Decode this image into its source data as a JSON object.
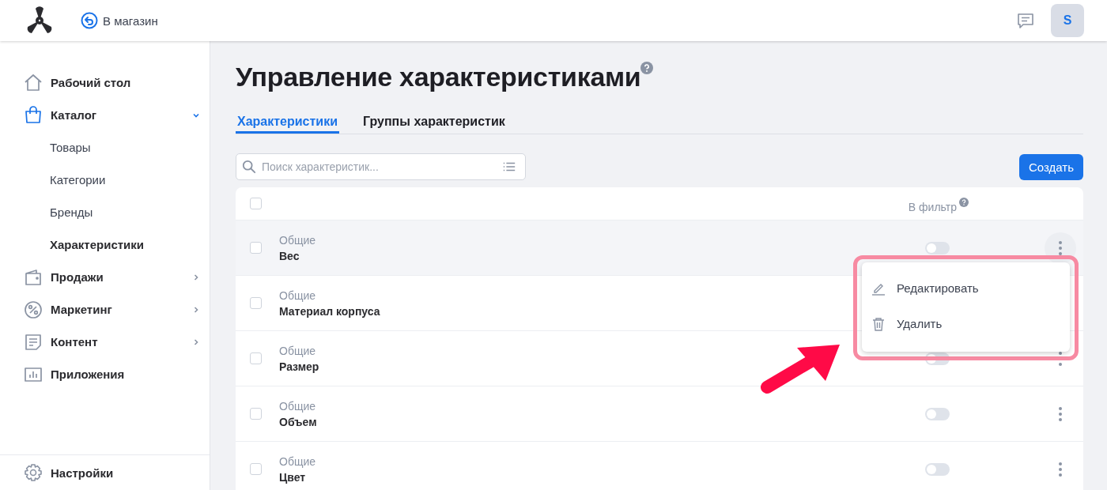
{
  "header": {
    "back_link": "В магазин",
    "avatar": "S"
  },
  "sidebar": {
    "items": [
      {
        "label": "Рабочий стол",
        "kind": "link"
      },
      {
        "label": "Каталог",
        "expanded": true,
        "kind": "group",
        "children": [
          {
            "label": "Товары",
            "selected": false
          },
          {
            "label": "Категории",
            "selected": false
          },
          {
            "label": "Бренды",
            "selected": false
          },
          {
            "label": "Характеристики",
            "selected": true
          }
        ]
      },
      {
        "label": "Продажи",
        "expanded": false,
        "kind": "group"
      },
      {
        "label": "Маркетинг",
        "expanded": false,
        "kind": "group"
      },
      {
        "label": "Контент",
        "expanded": false,
        "kind": "group"
      },
      {
        "label": "Приложения",
        "kind": "link"
      }
    ],
    "footer": "Настройки"
  },
  "page": {
    "title": "Управление характеристиками"
  },
  "tabs": [
    {
      "label": "Характеристики",
      "selected": true
    },
    {
      "label": "Группы характеристик",
      "selected": false
    }
  ],
  "search": {
    "placeholder": "Поиск характеристик..."
  },
  "create_button": "Создать",
  "table": {
    "header_checked": false,
    "filter_column": "В фильтр",
    "rows": [
      {
        "group": "Общие",
        "name": "Вес",
        "checked": false,
        "highlighted": true,
        "in_filter": false
      },
      {
        "group": "Общие",
        "name": "Материал корпуса",
        "checked": false
      },
      {
        "group": "Общие",
        "name": "Размер",
        "checked": false,
        "in_filter": false
      },
      {
        "group": "Общие",
        "name": "Объем",
        "checked": false,
        "in_filter": false
      },
      {
        "group": "Общие",
        "name": "Цвет",
        "checked": false,
        "in_filter": false
      }
    ]
  },
  "context_menu": {
    "items": [
      {
        "label": "Редактировать",
        "kind": "edit"
      },
      {
        "label": "Удалить",
        "kind": "delete"
      }
    ]
  }
}
